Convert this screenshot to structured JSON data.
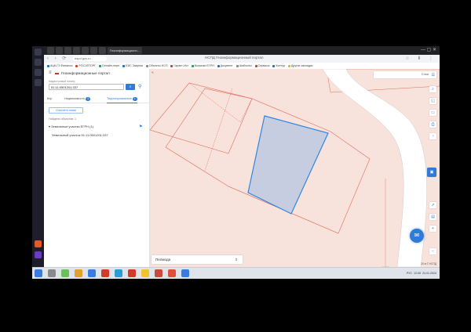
{
  "browser": {
    "active_tab": "Геоинформационн...",
    "window_title": "НСПД Геоинформационный портал",
    "url": "nspd.gov.ru",
    "window_controls": "— ▢ ✕",
    "bookmarks": [
      {
        "label": "АЦК-ГЗ Финансы",
        "color": "#1b6ec2"
      },
      {
        "label": "РОСЭЛТОРГ",
        "color": "#d23a2a"
      },
      {
        "label": "Онлайн-пере",
        "color": "#2a9d46"
      },
      {
        "label": "ЕИС Закупки",
        "color": "#1b6ec2"
      },
      {
        "label": "Объекты НСП",
        "color": "#888888"
      },
      {
        "label": "Гарант-Ист",
        "color": "#d23a2a"
      },
      {
        "label": "Выписки ЕГРН",
        "color": "#2a9d46"
      },
      {
        "label": "Документ",
        "color": "#1b6ec2"
      },
      {
        "label": "Шаблоны",
        "color": "#888888"
      },
      {
        "label": "Сервисы",
        "color": "#d23a2a"
      },
      {
        "label": "Контур",
        "color": "#1b6ec2"
      },
      {
        "label": "Другие закладки",
        "color": "#e2b02a"
      }
    ]
  },
  "panel": {
    "title": "Геоинформационные портал",
    "input_label": "Кадастровый номер",
    "input_value": "51:11:0501201:337",
    "search_icon": "search-icon",
    "tabs": [
      {
        "label": "Кнр",
        "badge": ""
      },
      {
        "label": "Недвижимость",
        "badge": "1"
      },
      {
        "label": "Территориальные",
        "badge": "1"
      }
    ],
    "clear_button": "Очистить поиск",
    "found_text": "Найдено объектов: 1",
    "group_label": "Земельные участки ЕГРН (1)",
    "result_row": "Земельный участок  51:11:0501201:337"
  },
  "map": {
    "layers_label": "Слои",
    "basemap_select": "Пелмода",
    "scale_text": "20 м  © НСПД",
    "tools": [
      "search-icon",
      "layers-icon",
      "measure-icon",
      "print-icon",
      "share-icon",
      "info-icon",
      "ruler-icon",
      "fullscreen-icon",
      "zoom-in-icon",
      "zoom-out-icon"
    ]
  },
  "taskbar": {
    "clock": "12:05",
    "date": "24.01.2024",
    "lang": "РУС"
  },
  "colors": {
    "accent": "#2f7bd6",
    "parcel_fill": "#c7cde0",
    "parcel_stroke": "#2f86e0",
    "map_bg": "#f7e3dc",
    "boundary": "#e66a5a",
    "road": "#ffffff"
  }
}
